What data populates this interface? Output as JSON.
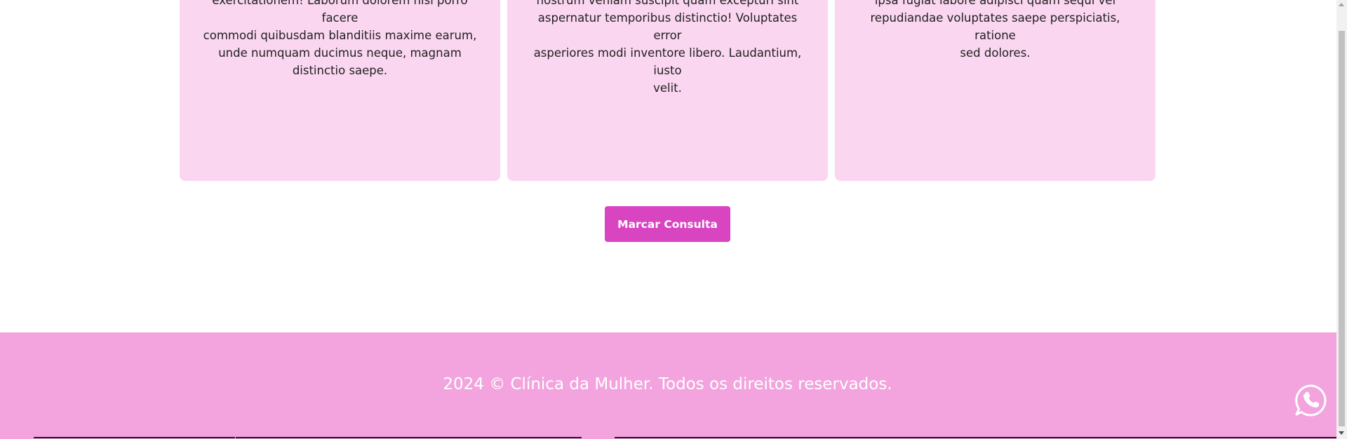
{
  "cards": [
    {
      "text_lines": [
        "exercitationem! Laborum dolorem nisi porro facere",
        "commodi quibusdam blanditiis maxime earum,",
        "unde numquam ducimus neque, magnam",
        "distinctio saepe."
      ]
    },
    {
      "text_lines": [
        "nostrum veniam suscipit quam excepturi sint",
        "aspernatur temporibus distinctio! Voluptates error",
        "asperiores modi inventore libero. Laudantium, iusto",
        "velit."
      ]
    },
    {
      "text_lines": [
        "ipsa fugiat labore adipisci quam sequi vel",
        "repudiandae voluptates saepe perspiciatis, ratione",
        "sed dolores."
      ]
    }
  ],
  "cta": {
    "label": "Marcar Consulta"
  },
  "footer": {
    "text": "2024 © Clínica da Mulher. Todos os direitos reservados."
  },
  "whatsapp": {
    "icon": "whatsapp-icon"
  },
  "colors": {
    "card_bg": "#fad6f0",
    "button_bg": "#d944c1",
    "footer_bg": "#f3a4de",
    "footer_text": "#ffffff"
  }
}
